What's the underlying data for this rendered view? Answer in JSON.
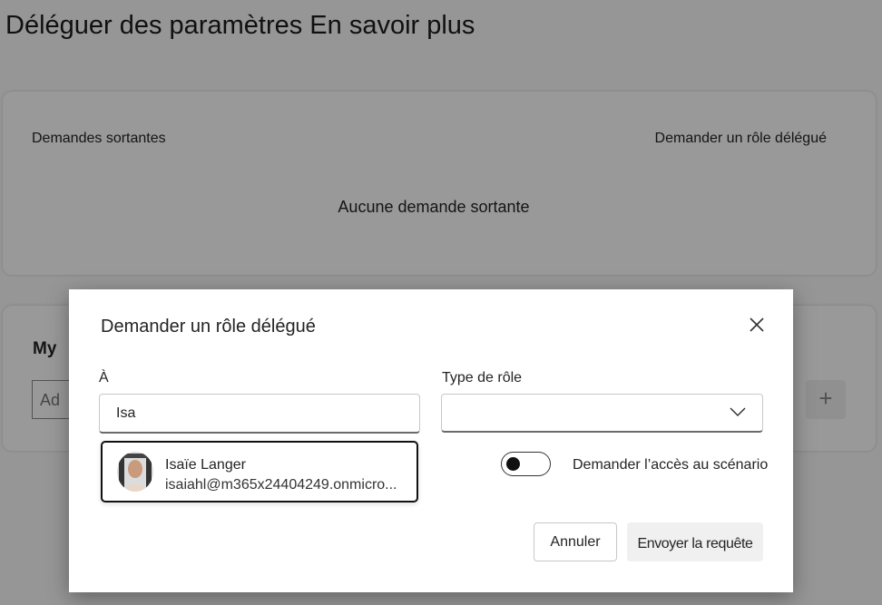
{
  "page": {
    "title": "Déléguer des paramètres En savoir plus"
  },
  "outgoing_card": {
    "label": "Demandes sortantes",
    "action": "Demander un rôle délégué",
    "empty_text": "Aucune demande sortante"
  },
  "my_card": {
    "title": "My",
    "input_partial": "Ad",
    "add_icon": "plus-icon"
  },
  "dialog": {
    "title": "Demander un rôle délégué",
    "close_icon": "close-icon",
    "to_label": "À",
    "to_value": "Isa",
    "role_type_label": "Type de rôle",
    "role_type_value": "",
    "suggestion": {
      "name": "Isaïe Langer",
      "email": "isaiahl@m365x24404249.onmicro...",
      "avatar_icon": "user-avatar"
    },
    "scenario_toggle_label": "Demander l’accès au scénario",
    "scenario_toggle_on": false,
    "cancel_label": "Annuler",
    "send_label": "Envoyer la requête"
  }
}
